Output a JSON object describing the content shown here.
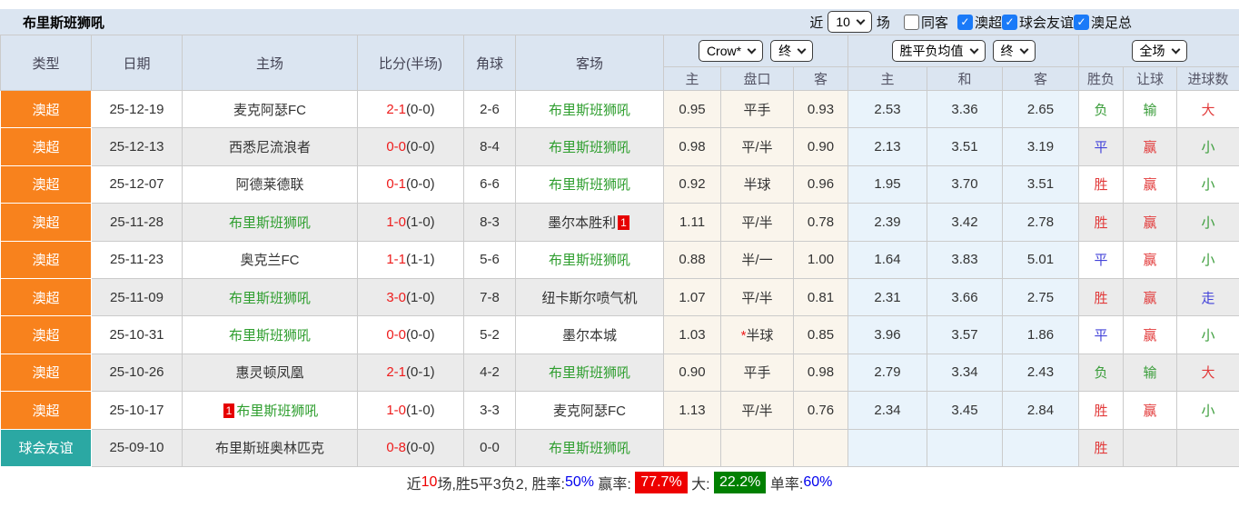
{
  "title": "布里斯班狮吼",
  "topbar": {
    "recent_label": "近",
    "recent_value": "10",
    "games_label": "场",
    "checkboxes": [
      {
        "label": "同客",
        "checked": false
      },
      {
        "label": "澳超",
        "checked": true
      },
      {
        "label": "球会友谊",
        "checked": true
      },
      {
        "label": "澳足总",
        "checked": true
      }
    ]
  },
  "table": {
    "main_headers": [
      "类型",
      "日期",
      "主场",
      "比分(半场)",
      "角球",
      "客场"
    ],
    "selects": {
      "odds_company": "Crow*",
      "odds_state": "终",
      "avg_metric": "胜平负均值",
      "avg_state": "终",
      "scope": "全场"
    },
    "sub_headers": [
      "主",
      "盘口",
      "客",
      "主",
      "和",
      "客",
      "胜负",
      "让球",
      "进球数"
    ],
    "rows": [
      {
        "type": "澳超",
        "type_style": "league",
        "date": "25-12-19",
        "home": {
          "name": "麦克阿瑟FC",
          "green": false,
          "badge": "",
          "badge_pos": ""
        },
        "score": "2-1",
        "half": "(0-0)",
        "corners": "2-6",
        "away": {
          "name": "布里斯班狮吼",
          "green": true,
          "badge": "",
          "badge_pos": ""
        },
        "odds": [
          "0.95",
          "平手",
          "0.93"
        ],
        "odds_star": false,
        "avg": [
          "2.53",
          "3.36",
          "2.65"
        ],
        "results": [
          {
            "text": "负",
            "color": "green"
          },
          {
            "text": "输",
            "color": "green"
          },
          {
            "text": "大",
            "color": "red"
          }
        ]
      },
      {
        "type": "澳超",
        "type_style": "league",
        "date": "25-12-13",
        "home": {
          "name": "西悉尼流浪者",
          "green": false,
          "badge": "",
          "badge_pos": ""
        },
        "score": "0-0",
        "half": "(0-0)",
        "corners": "8-4",
        "away": {
          "name": "布里斯班狮吼",
          "green": true,
          "badge": "",
          "badge_pos": ""
        },
        "odds": [
          "0.98",
          "平/半",
          "0.90"
        ],
        "odds_star": false,
        "avg": [
          "2.13",
          "3.51",
          "3.19"
        ],
        "results": [
          {
            "text": "平",
            "color": "blue"
          },
          {
            "text": "赢",
            "color": "red"
          },
          {
            "text": "小",
            "color": "green"
          }
        ]
      },
      {
        "type": "澳超",
        "type_style": "league",
        "date": "25-12-07",
        "home": {
          "name": "阿德莱德联",
          "green": false,
          "badge": "",
          "badge_pos": ""
        },
        "score": "0-1",
        "half": "(0-0)",
        "corners": "6-6",
        "away": {
          "name": "布里斯班狮吼",
          "green": true,
          "badge": "",
          "badge_pos": ""
        },
        "odds": [
          "0.92",
          "半球",
          "0.96"
        ],
        "odds_star": false,
        "avg": [
          "1.95",
          "3.70",
          "3.51"
        ],
        "results": [
          {
            "text": "胜",
            "color": "red"
          },
          {
            "text": "赢",
            "color": "red"
          },
          {
            "text": "小",
            "color": "green"
          }
        ]
      },
      {
        "type": "澳超",
        "type_style": "league",
        "date": "25-11-28",
        "home": {
          "name": "布里斯班狮吼",
          "green": true,
          "badge": "",
          "badge_pos": ""
        },
        "score": "1-0",
        "half": "(1-0)",
        "corners": "8-3",
        "away": {
          "name": "墨尔本胜利",
          "green": false,
          "badge": "1",
          "badge_pos": "after"
        },
        "odds": [
          "1.11",
          "平/半",
          "0.78"
        ],
        "odds_star": false,
        "avg": [
          "2.39",
          "3.42",
          "2.78"
        ],
        "results": [
          {
            "text": "胜",
            "color": "red"
          },
          {
            "text": "赢",
            "color": "red"
          },
          {
            "text": "小",
            "color": "green"
          }
        ]
      },
      {
        "type": "澳超",
        "type_style": "league",
        "date": "25-11-23",
        "home": {
          "name": "奥克兰FC",
          "green": false,
          "badge": "",
          "badge_pos": ""
        },
        "score": "1-1",
        "half": "(1-1)",
        "corners": "5-6",
        "away": {
          "name": "布里斯班狮吼",
          "green": true,
          "badge": "",
          "badge_pos": ""
        },
        "odds": [
          "0.88",
          "半/一",
          "1.00"
        ],
        "odds_star": false,
        "avg": [
          "1.64",
          "3.83",
          "5.01"
        ],
        "results": [
          {
            "text": "平",
            "color": "blue"
          },
          {
            "text": "赢",
            "color": "red"
          },
          {
            "text": "小",
            "color": "green"
          }
        ]
      },
      {
        "type": "澳超",
        "type_style": "league",
        "date": "25-11-09",
        "home": {
          "name": "布里斯班狮吼",
          "green": true,
          "badge": "",
          "badge_pos": ""
        },
        "score": "3-0",
        "half": "(1-0)",
        "corners": "7-8",
        "away": {
          "name": "纽卡斯尔喷气机",
          "green": false,
          "badge": "",
          "badge_pos": ""
        },
        "odds": [
          "1.07",
          "平/半",
          "0.81"
        ],
        "odds_star": false,
        "avg": [
          "2.31",
          "3.66",
          "2.75"
        ],
        "results": [
          {
            "text": "胜",
            "color": "red"
          },
          {
            "text": "赢",
            "color": "red"
          },
          {
            "text": "走",
            "color": "blue"
          }
        ]
      },
      {
        "type": "澳超",
        "type_style": "league",
        "date": "25-10-31",
        "home": {
          "name": "布里斯班狮吼",
          "green": true,
          "badge": "",
          "badge_pos": ""
        },
        "score": "0-0",
        "half": "(0-0)",
        "corners": "5-2",
        "away": {
          "name": "墨尔本城",
          "green": false,
          "badge": "",
          "badge_pos": ""
        },
        "odds": [
          "1.03",
          "半球",
          "0.85"
        ],
        "odds_star": true,
        "avg": [
          "3.96",
          "3.57",
          "1.86"
        ],
        "results": [
          {
            "text": "平",
            "color": "blue"
          },
          {
            "text": "赢",
            "color": "red"
          },
          {
            "text": "小",
            "color": "green"
          }
        ]
      },
      {
        "type": "澳超",
        "type_style": "league",
        "date": "25-10-26",
        "home": {
          "name": "惠灵顿凤凰",
          "green": false,
          "badge": "",
          "badge_pos": ""
        },
        "score": "2-1",
        "half": "(0-1)",
        "corners": "4-2",
        "away": {
          "name": "布里斯班狮吼",
          "green": true,
          "badge": "",
          "badge_pos": ""
        },
        "odds": [
          "0.90",
          "平手",
          "0.98"
        ],
        "odds_star": false,
        "avg": [
          "2.79",
          "3.34",
          "2.43"
        ],
        "results": [
          {
            "text": "负",
            "color": "green"
          },
          {
            "text": "输",
            "color": "green"
          },
          {
            "text": "大",
            "color": "red"
          }
        ]
      },
      {
        "type": "澳超",
        "type_style": "league",
        "date": "25-10-17",
        "home": {
          "name": "布里斯班狮吼",
          "green": true,
          "badge": "1",
          "badge_pos": "before"
        },
        "score": "1-0",
        "half": "(1-0)",
        "corners": "3-3",
        "away": {
          "name": "麦克阿瑟FC",
          "green": false,
          "badge": "",
          "badge_pos": ""
        },
        "odds": [
          "1.13",
          "平/半",
          "0.76"
        ],
        "odds_star": false,
        "avg": [
          "2.34",
          "3.45",
          "2.84"
        ],
        "results": [
          {
            "text": "胜",
            "color": "red"
          },
          {
            "text": "赢",
            "color": "red"
          },
          {
            "text": "小",
            "color": "green"
          }
        ]
      },
      {
        "type": "球会友谊",
        "type_style": "friendly",
        "date": "25-09-10",
        "home": {
          "name": "布里斯班奥林匹克",
          "green": false,
          "badge": "",
          "badge_pos": ""
        },
        "score": "0-8",
        "half": "(0-0)",
        "corners": "0-0",
        "away": {
          "name": "布里斯班狮吼",
          "green": true,
          "badge": "",
          "badge_pos": ""
        },
        "odds": [
          "",
          "",
          ""
        ],
        "odds_star": false,
        "avg": [
          "",
          "",
          ""
        ],
        "results": [
          {
            "text": "胜",
            "color": "red"
          },
          {
            "text": "",
            "color": ""
          },
          {
            "text": "",
            "color": ""
          }
        ]
      }
    ]
  },
  "summary": {
    "segments": [
      {
        "text": "近",
        "style": "plain"
      },
      {
        "text": "10",
        "style": "red"
      },
      {
        "text": "场,胜5平3负2, 胜率:",
        "style": "plain"
      },
      {
        "text": "50%",
        "style": "blue"
      },
      {
        "text": " 赢率: ",
        "style": "plain"
      },
      {
        "text": "77.7%",
        "style": "badge-red"
      },
      {
        "text": " 大: ",
        "style": "plain"
      },
      {
        "text": "22.2%",
        "style": "badge-green"
      },
      {
        "text": " 单率:",
        "style": "plain"
      },
      {
        "text": "60%",
        "style": "blue"
      }
    ]
  },
  "colors": {
    "accent_orange": "#f8821d",
    "accent_teal": "#2ba8a3",
    "header_bg": "#dbe5f1",
    "row_alt": "#ebebeb",
    "odds_col_bg": "#faf5ec",
    "avg_col_bg": "#e9f3fb",
    "team_green": "#2e9e2e",
    "score_red": "#ee1c1c",
    "result_red": "#e23b3b",
    "result_green": "#3a9d3a",
    "result_blue": "#4343d9",
    "summary_badge_red": "#ee0000",
    "summary_badge_green": "#008000",
    "summary_blue": "#0000ee",
    "checkbox_blue": "#1a7af8"
  }
}
